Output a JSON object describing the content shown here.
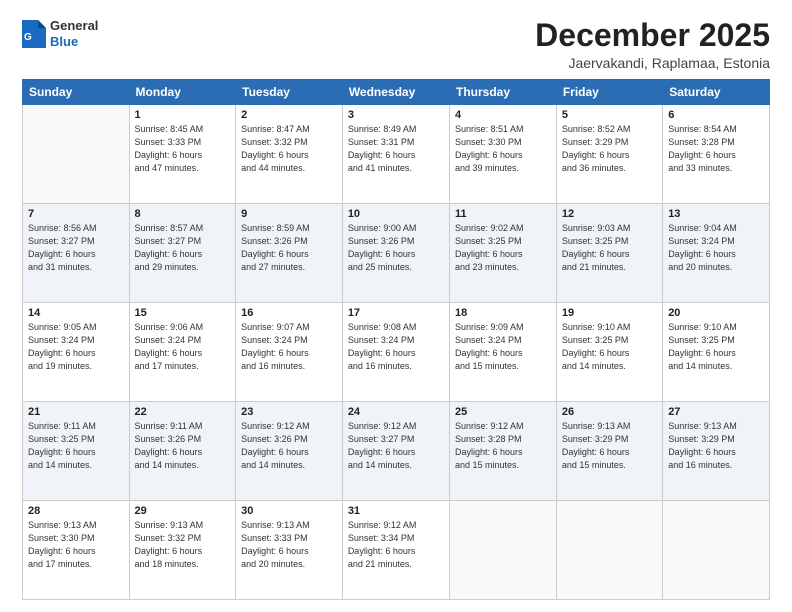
{
  "logo": {
    "general": "General",
    "blue": "Blue"
  },
  "header": {
    "month": "December 2025",
    "location": "Jaervakandi, Raplamaa, Estonia"
  },
  "days_of_week": [
    "Sunday",
    "Monday",
    "Tuesday",
    "Wednesday",
    "Thursday",
    "Friday",
    "Saturday"
  ],
  "weeks": [
    [
      {
        "day": "",
        "info": ""
      },
      {
        "day": "1",
        "info": "Sunrise: 8:45 AM\nSunset: 3:33 PM\nDaylight: 6 hours\nand 47 minutes."
      },
      {
        "day": "2",
        "info": "Sunrise: 8:47 AM\nSunset: 3:32 PM\nDaylight: 6 hours\nand 44 minutes."
      },
      {
        "day": "3",
        "info": "Sunrise: 8:49 AM\nSunset: 3:31 PM\nDaylight: 6 hours\nand 41 minutes."
      },
      {
        "day": "4",
        "info": "Sunrise: 8:51 AM\nSunset: 3:30 PM\nDaylight: 6 hours\nand 39 minutes."
      },
      {
        "day": "5",
        "info": "Sunrise: 8:52 AM\nSunset: 3:29 PM\nDaylight: 6 hours\nand 36 minutes."
      },
      {
        "day": "6",
        "info": "Sunrise: 8:54 AM\nSunset: 3:28 PM\nDaylight: 6 hours\nand 33 minutes."
      }
    ],
    [
      {
        "day": "7",
        "info": "Sunrise: 8:56 AM\nSunset: 3:27 PM\nDaylight: 6 hours\nand 31 minutes."
      },
      {
        "day": "8",
        "info": "Sunrise: 8:57 AM\nSunset: 3:27 PM\nDaylight: 6 hours\nand 29 minutes."
      },
      {
        "day": "9",
        "info": "Sunrise: 8:59 AM\nSunset: 3:26 PM\nDaylight: 6 hours\nand 27 minutes."
      },
      {
        "day": "10",
        "info": "Sunrise: 9:00 AM\nSunset: 3:26 PM\nDaylight: 6 hours\nand 25 minutes."
      },
      {
        "day": "11",
        "info": "Sunrise: 9:02 AM\nSunset: 3:25 PM\nDaylight: 6 hours\nand 23 minutes."
      },
      {
        "day": "12",
        "info": "Sunrise: 9:03 AM\nSunset: 3:25 PM\nDaylight: 6 hours\nand 21 minutes."
      },
      {
        "day": "13",
        "info": "Sunrise: 9:04 AM\nSunset: 3:24 PM\nDaylight: 6 hours\nand 20 minutes."
      }
    ],
    [
      {
        "day": "14",
        "info": "Sunrise: 9:05 AM\nSunset: 3:24 PM\nDaylight: 6 hours\nand 19 minutes."
      },
      {
        "day": "15",
        "info": "Sunrise: 9:06 AM\nSunset: 3:24 PM\nDaylight: 6 hours\nand 17 minutes."
      },
      {
        "day": "16",
        "info": "Sunrise: 9:07 AM\nSunset: 3:24 PM\nDaylight: 6 hours\nand 16 minutes."
      },
      {
        "day": "17",
        "info": "Sunrise: 9:08 AM\nSunset: 3:24 PM\nDaylight: 6 hours\nand 16 minutes."
      },
      {
        "day": "18",
        "info": "Sunrise: 9:09 AM\nSunset: 3:24 PM\nDaylight: 6 hours\nand 15 minutes."
      },
      {
        "day": "19",
        "info": "Sunrise: 9:10 AM\nSunset: 3:25 PM\nDaylight: 6 hours\nand 14 minutes."
      },
      {
        "day": "20",
        "info": "Sunrise: 9:10 AM\nSunset: 3:25 PM\nDaylight: 6 hours\nand 14 minutes."
      }
    ],
    [
      {
        "day": "21",
        "info": "Sunrise: 9:11 AM\nSunset: 3:25 PM\nDaylight: 6 hours\nand 14 minutes."
      },
      {
        "day": "22",
        "info": "Sunrise: 9:11 AM\nSunset: 3:26 PM\nDaylight: 6 hours\nand 14 minutes."
      },
      {
        "day": "23",
        "info": "Sunrise: 9:12 AM\nSunset: 3:26 PM\nDaylight: 6 hours\nand 14 minutes."
      },
      {
        "day": "24",
        "info": "Sunrise: 9:12 AM\nSunset: 3:27 PM\nDaylight: 6 hours\nand 14 minutes."
      },
      {
        "day": "25",
        "info": "Sunrise: 9:12 AM\nSunset: 3:28 PM\nDaylight: 6 hours\nand 15 minutes."
      },
      {
        "day": "26",
        "info": "Sunrise: 9:13 AM\nSunset: 3:29 PM\nDaylight: 6 hours\nand 15 minutes."
      },
      {
        "day": "27",
        "info": "Sunrise: 9:13 AM\nSunset: 3:29 PM\nDaylight: 6 hours\nand 16 minutes."
      }
    ],
    [
      {
        "day": "28",
        "info": "Sunrise: 9:13 AM\nSunset: 3:30 PM\nDaylight: 6 hours\nand 17 minutes."
      },
      {
        "day": "29",
        "info": "Sunrise: 9:13 AM\nSunset: 3:32 PM\nDaylight: 6 hours\nand 18 minutes."
      },
      {
        "day": "30",
        "info": "Sunrise: 9:13 AM\nSunset: 3:33 PM\nDaylight: 6 hours\nand 20 minutes."
      },
      {
        "day": "31",
        "info": "Sunrise: 9:12 AM\nSunset: 3:34 PM\nDaylight: 6 hours\nand 21 minutes."
      },
      {
        "day": "",
        "info": ""
      },
      {
        "day": "",
        "info": ""
      },
      {
        "day": "",
        "info": ""
      }
    ]
  ]
}
